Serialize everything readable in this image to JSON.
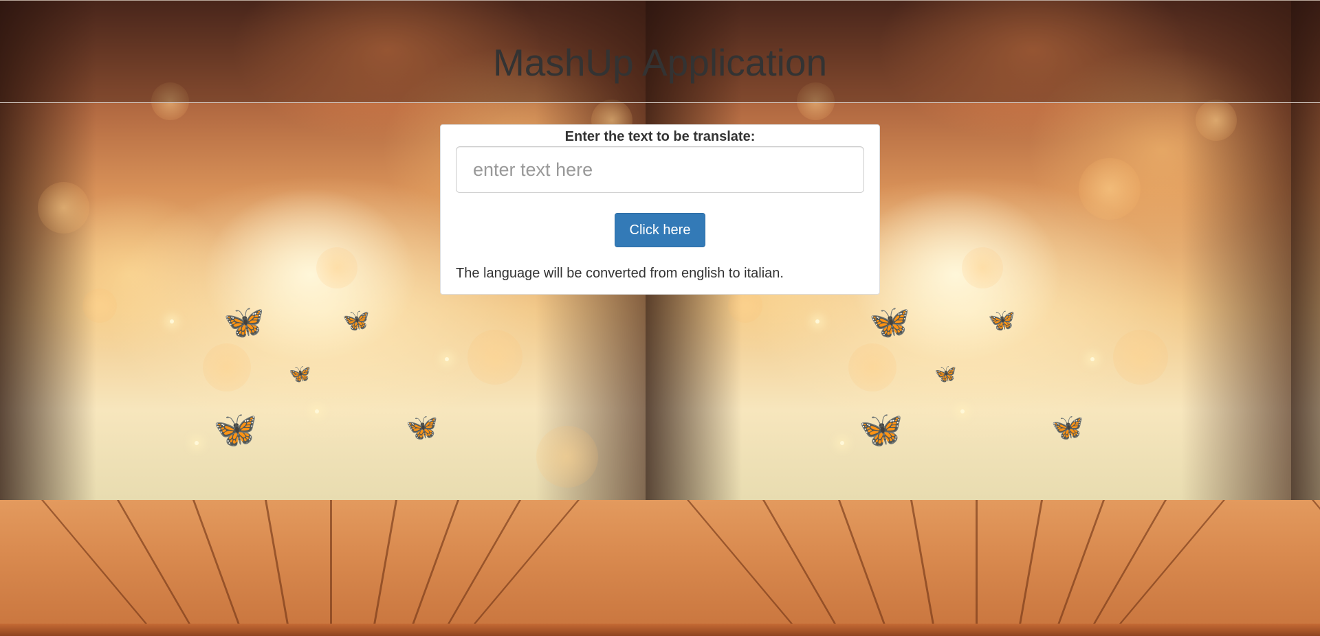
{
  "header": {
    "title": "MashUp Application"
  },
  "form": {
    "label": "Enter the text to be translate:",
    "input_placeholder": "enter text here",
    "input_value": "",
    "button_label": "Click here",
    "note": "The language will be converted from english to italian."
  },
  "colors": {
    "button": "#337ab7",
    "panel": "#ffffff",
    "title_text": "#333333"
  },
  "icons": [
    "butterfly-icon"
  ]
}
